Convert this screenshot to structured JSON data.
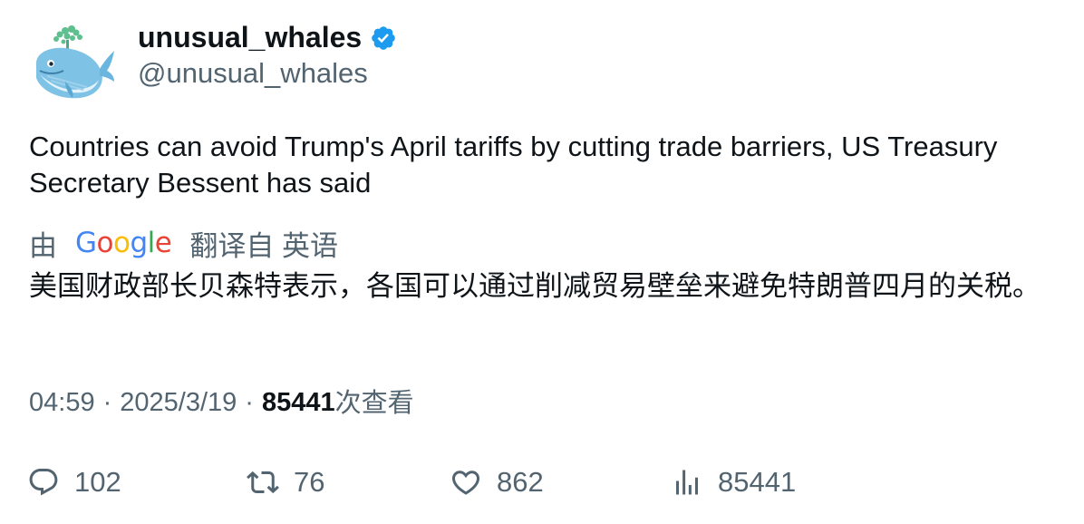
{
  "author": {
    "display_name": "unusual_whales",
    "handle": "@unusual_whales",
    "verified_icon": "verified-badge-icon",
    "avatar_icon": "whale-avatar"
  },
  "tweet": {
    "text": "Countries can avoid Trump's April tariffs by cutting trade barriers, US Treasury Secretary Bessent has said"
  },
  "translation": {
    "prefix": "由",
    "provider": "Google",
    "suffix": "翻译自 英语",
    "text": "美国财政部长贝森特表示，各国可以通过削减贸易壁垒来避免特朗普四月的关税。"
  },
  "meta": {
    "time": "04:59",
    "date": "2025/3/19",
    "views_count": "85441",
    "views_label": "次查看"
  },
  "actions": {
    "replies": "102",
    "retweets": "76",
    "likes": "862",
    "views": "85441"
  },
  "colors": {
    "text_primary": "#0f1419",
    "text_secondary": "#536471",
    "verified_blue": "#1d9bf0"
  }
}
